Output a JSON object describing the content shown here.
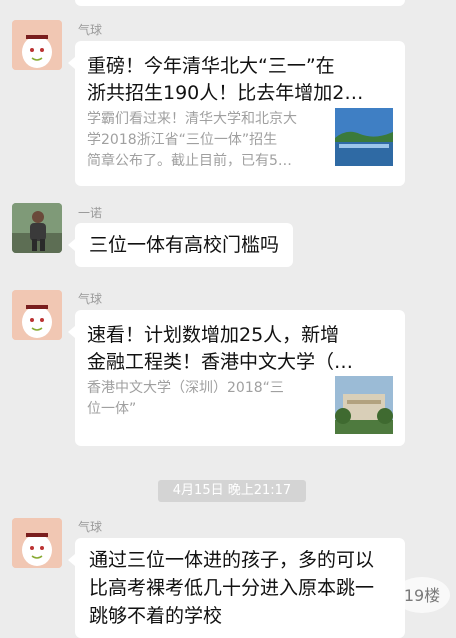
{
  "messages": [
    {
      "sender": "气球",
      "type": "card",
      "title_line1": "重磅！今年清华北大“三一”在",
      "title_line2": "浙共招生190人！比去年增加2…",
      "desc_line1": "学霸们看过来！清华大学和北京大",
      "desc_line2": "学2018浙江省“三位一体”招生",
      "desc_line3": "简章公布了。截止目前，已有5…"
    },
    {
      "sender": "一诺",
      "type": "text",
      "text": "三位一体有高校门槛吗"
    },
    {
      "sender": "气球",
      "type": "card",
      "title_line1": "速看！计划数增加25人，新增",
      "title_line2": "金融工程类！香港中文大学（…",
      "desc_line1": "香港中文大学（深圳）2018“三",
      "desc_line2": "位一体”"
    },
    {
      "sender": "气球",
      "type": "text",
      "line1": "通过三位一体进的孩子，多的可以",
      "line2": "比高考裸考低几十分进入原本跳一",
      "line3": "跳够不着的学校"
    }
  ],
  "timestamp": "4月15日 晚上21:17",
  "watermark": "19楼",
  "colors": {
    "background": "#ececec",
    "bubble": "#ffffff",
    "title_text": "#111111",
    "desc_text": "#a0a0a0"
  }
}
